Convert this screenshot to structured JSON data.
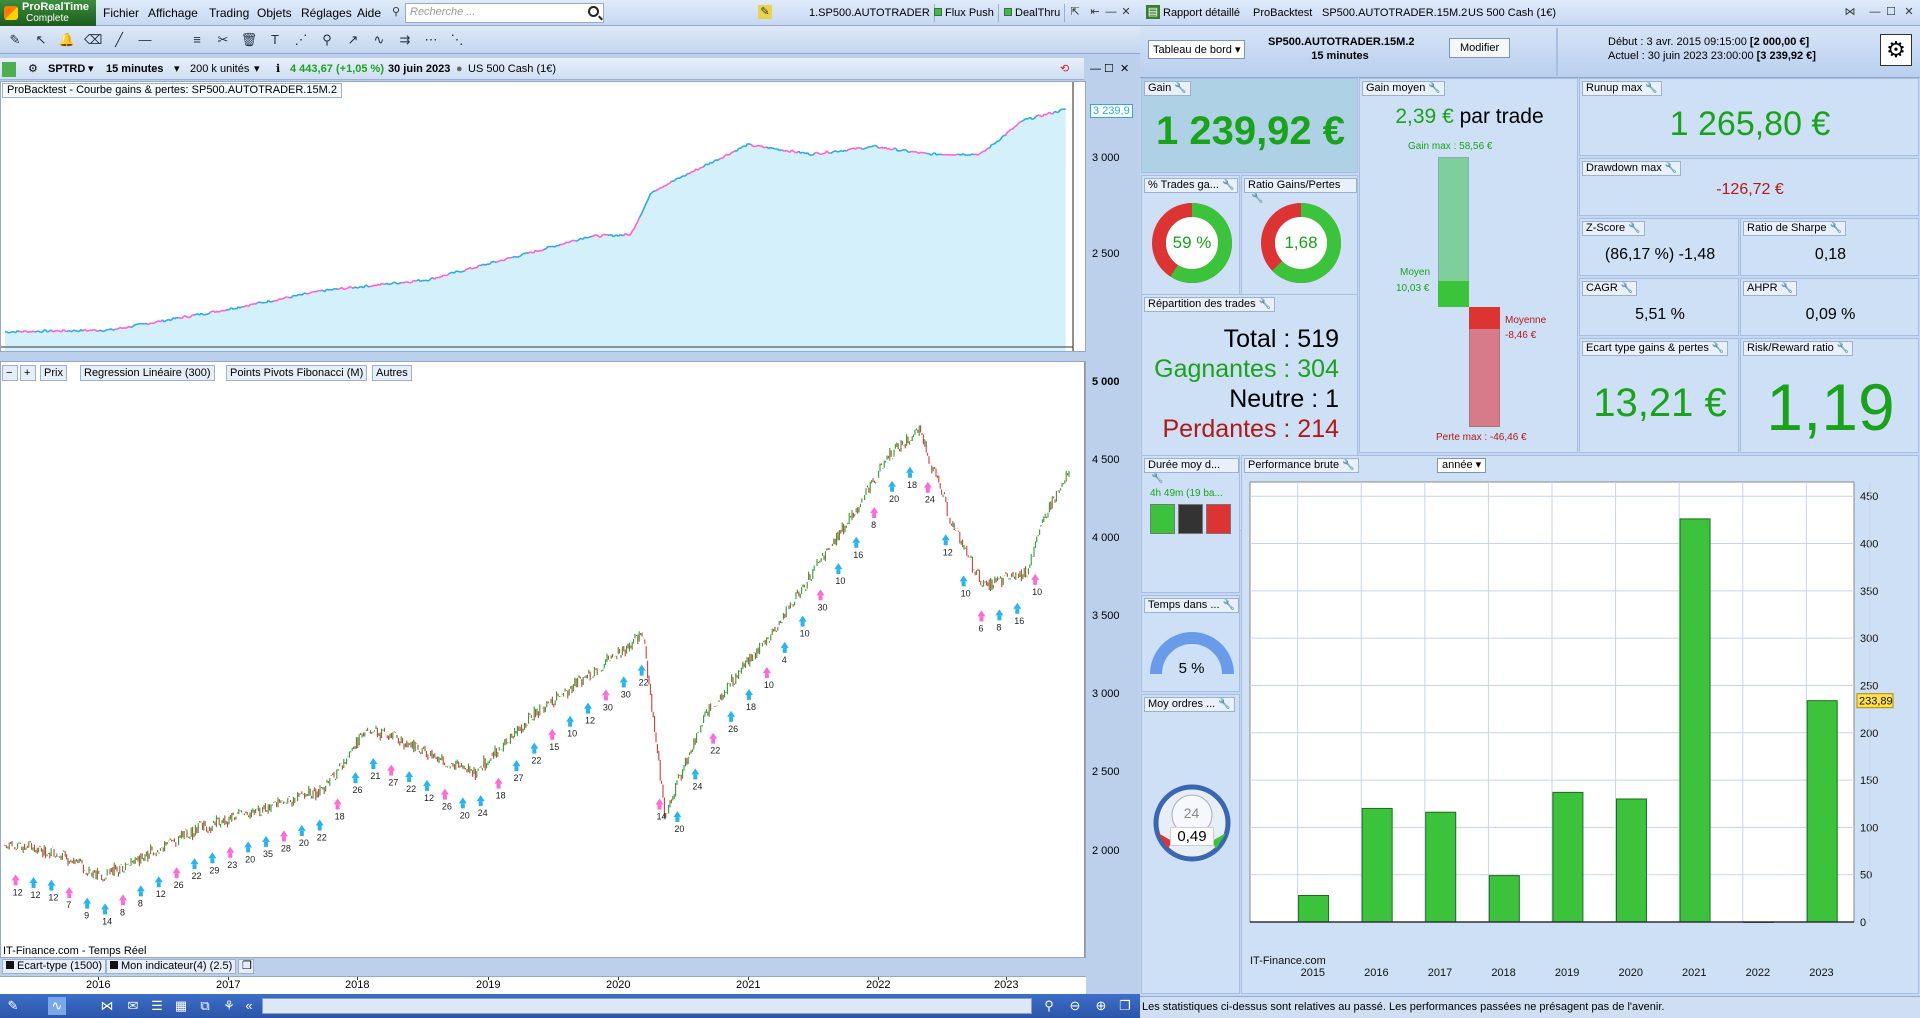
{
  "app": {
    "name": "ProRealTime",
    "edition": "Complete"
  },
  "menu": [
    "Fichier",
    "Affichage",
    "Trading",
    "Objets",
    "Réglages",
    "Aide"
  ],
  "search": {
    "placeholder": "Recherche ..."
  },
  "top_tabs": [
    "1.SP500.AUTOTRADER",
    "Flux Push",
    "DealThru"
  ],
  "chart_header": {
    "symbol": "SPTRD",
    "timeframe": "15 minutes",
    "units": "200 k unités",
    "price": "4 443,67",
    "change": "(+1,05 %)",
    "date": "30 juin 2023",
    "instrument": "US 500 Cash (1€)"
  },
  "equity_label": "ProBacktest - Courbe gains & pertes: SP500.AUTOTRADER.15M.2",
  "equity_axis": {
    "ticks": [
      "3 000",
      "2 500"
    ],
    "last": "3 239,9"
  },
  "price_axis": {
    "ticks": [
      "5 000",
      "4 500",
      "4 000",
      "3 500",
      "3 000",
      "2 500",
      "2 000"
    ]
  },
  "price_bar": [
    "Prix",
    "Regression Linéaire (300)",
    "Points Pivots Fibonacci (M)",
    "Autres"
  ],
  "watermark": "IT-Finance.com - Temps Réel",
  "bottom_indicators": [
    "Ecart-type (1500)",
    "Mon indicateur(4) (2.5)"
  ],
  "x_years": [
    "2016",
    "2017",
    "2018",
    "2019",
    "2020",
    "2021",
    "2022",
    "2023"
  ],
  "trade_labels": [
    "12",
    "12",
    "12",
    "7",
    "9",
    "14",
    "8",
    "8",
    "12",
    "26",
    "22",
    "29",
    "23",
    "20",
    "35",
    "28",
    "20",
    "22",
    "18",
    "26",
    "21",
    "27",
    "22",
    "12",
    "26",
    "20",
    "24",
    "18",
    "27",
    "22",
    "15",
    "10",
    "12",
    "30",
    "30",
    "22",
    "14",
    "20",
    "24",
    "22",
    "26",
    "18",
    "10",
    "4",
    "10",
    "30",
    "10",
    "16",
    "8",
    "20",
    "18",
    "24",
    "12",
    "10",
    "6",
    "8",
    "16",
    "10"
  ],
  "right": {
    "tabs": [
      "Rapport détaillé",
      "ProBacktest",
      "SP500.AUTOTRADER.15M.2",
      "US 500 Cash (1€)"
    ],
    "dashboard_btn": "Tableau de bord",
    "system": "SP500.AUTOTRADER.15M.2",
    "timeframe": "15 minutes",
    "modify_btn": "Modifier",
    "debut_label": "Début :",
    "debut_date": "3 avr. 2015 09:15:00",
    "debut_val": "[2 000,00 €]",
    "actuel_label": "Actuel :",
    "actuel_date": "30 juin 2023 23:00:00",
    "actuel_val": "[3 239,92 €]",
    "gain_title": "Gain",
    "gain": "1 239,92 €",
    "pct_title": "% Trades ga...",
    "pct_value": "59 %",
    "ratio_title": "Ratio Gains/Pertes",
    "ratio_value": "1,68",
    "rep_title": "Répartition des trades",
    "total": "Total : 519",
    "gagnantes": "Gagnantes : 304",
    "neutre": "Neutre : 1",
    "perdantes": "Perdantes : 214",
    "gm_title": "Gain moyen",
    "gm_value": "2,39 €",
    "gm_suffix": " par trade",
    "gm_max": "Gain max : 58,56 €",
    "gm_moyen": "Moyen",
    "gm_moyen_val": "10,03 €",
    "gm_moyenne": "Moyenne",
    "gm_moyenne_val": "-8,46 €",
    "gm_perte": "Perte max : -46,46 €",
    "runup_title": "Runup max",
    "runup": "1 265,80 €",
    "dd_title": "Drawdown max",
    "dd": "-126,72 €",
    "z_title": "Z-Score",
    "z": "(86,17 %) -1,48",
    "sharpe_title": "Ratio de Sharpe",
    "sharpe": "0,18",
    "cagr_title": "CAGR",
    "cagr": "5,51 %",
    "ahpr_title": "AHPR",
    "ahpr": "0,09 %",
    "ecart_title": "Ecart type gains & pertes",
    "ecart": "13,21 €",
    "rr_title": "Risk/Reward ratio",
    "rr": "1,19",
    "duree_title": "Durée moy d...",
    "duree": "4h 49m (19 ba...",
    "temps_title": "Temps dans ...",
    "temps": "5 %",
    "moy_title": "Moy ordres ...",
    "moy_gauge": "24",
    "moy_val": "0,49",
    "perf_title": "Performance brute",
    "perf_select": "année",
    "perf_watermark": "IT-Finance.com",
    "status": "Les statistiques ci-dessus sont relatives au passé. Les performances passées ne présagent pas de l'avenir."
  },
  "chart_data": [
    {
      "type": "line",
      "name": "equity",
      "ylim": [
        2000,
        3300
      ],
      "last": 3239.92
    },
    {
      "type": "bar",
      "x": [
        "2015",
        "2016",
        "2017",
        "2018",
        "2019",
        "2020",
        "2021",
        "2022",
        "2023"
      ],
      "values": [
        28,
        120,
        116,
        49,
        137,
        130,
        426,
        0,
        233.89
      ],
      "ylim": [
        0,
        465
      ],
      "yticks": [
        0,
        50,
        100,
        150,
        200,
        250,
        300,
        350,
        400,
        450
      ],
      "last_label": "233,89",
      "ylabel": "",
      "xlabel": "",
      "title": ""
    }
  ]
}
